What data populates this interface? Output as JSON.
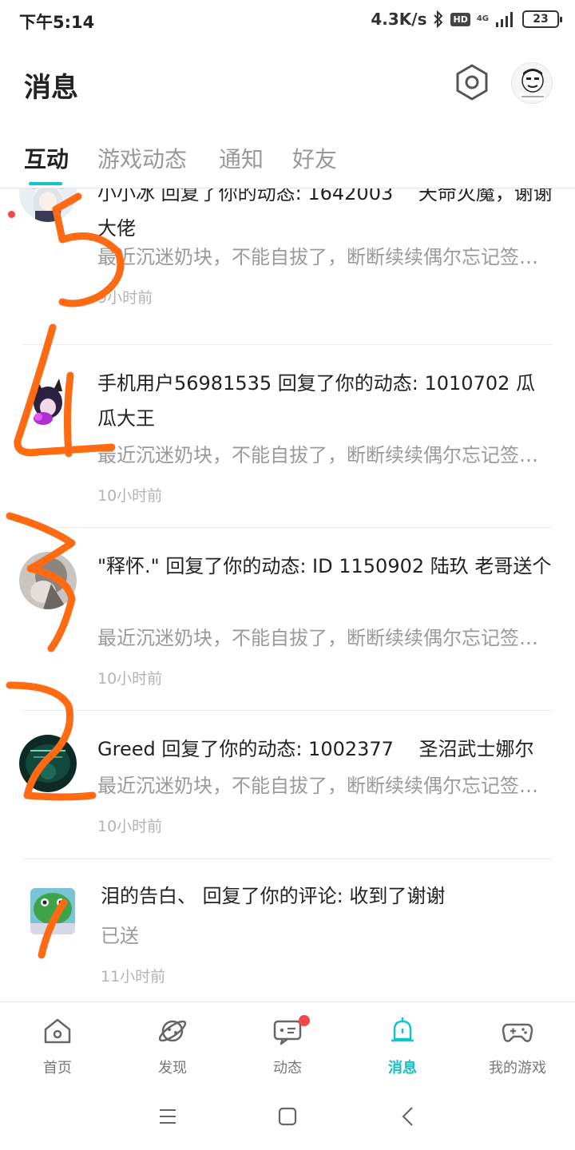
{
  "status_bar": {
    "time": "下午5:14",
    "net_speed": "4.3K/s",
    "hd": "HD",
    "network": "4G",
    "battery": "23"
  },
  "header": {
    "title": "消息",
    "settings_icon": "gear-icon"
  },
  "tabs": [
    {
      "label": "互动",
      "active": true
    },
    {
      "label": "游戏动态",
      "active": false
    },
    {
      "label": "通知",
      "active": false
    },
    {
      "label": "好友",
      "active": false
    }
  ],
  "messages": [
    {
      "title": "小小冰 回复了你的动态: 1642003　 天命灭魔，谢谢大佬",
      "snippet": "最近沉迷奶块，不能自拔了，断断续续偶尔忘记签到，这次来还…",
      "time": "9小时前",
      "unread": true
    },
    {
      "title": "手机用户56981535 回复了你的动态: 1010702 瓜瓜大王",
      "snippet": "最近沉迷奶块，不能自拔了，断断续续偶尔忘记签到，这次来还…",
      "time": "10小时前",
      "unread": false
    },
    {
      "title": "\"释怀.\" 回复了你的动态: ID 1150902  陆玖  老哥送个",
      "snippet": "最近沉迷奶块，不能自拔了，断断续续偶尔忘记签到，这次来还…",
      "time": "10小时前",
      "unread": false
    },
    {
      "title": "Greed 回复了你的动态: 1002377　 圣沼武士娜尔",
      "snippet": "最近沉迷奶块，不能自拔了，断断续续偶尔忘记签到，这次来还…",
      "time": "10小时前",
      "unread": false
    },
    {
      "title": "泪的告白、 回复了你的评论: 收到了谢谢",
      "snippet": "已送",
      "time": "11小时前",
      "unread": false
    }
  ],
  "bottom_nav": [
    {
      "label": "首页",
      "icon": "home-icon",
      "active": false
    },
    {
      "label": "发现",
      "icon": "planet-icon",
      "active": false
    },
    {
      "label": "动态",
      "icon": "chat-icon",
      "active": false,
      "badge": true
    },
    {
      "label": "消息",
      "icon": "bell-icon",
      "active": true
    },
    {
      "label": "我的游戏",
      "icon": "gamepad-icon",
      "active": false
    }
  ],
  "system_nav": [
    "menu-icon",
    "home-square-icon",
    "back-icon"
  ],
  "colors": {
    "accent": "#14c4c8",
    "badge": "#f0484b",
    "annotation": "#ff6a13"
  },
  "annotations": [
    "5",
    "4",
    "3",
    "2",
    "1"
  ]
}
